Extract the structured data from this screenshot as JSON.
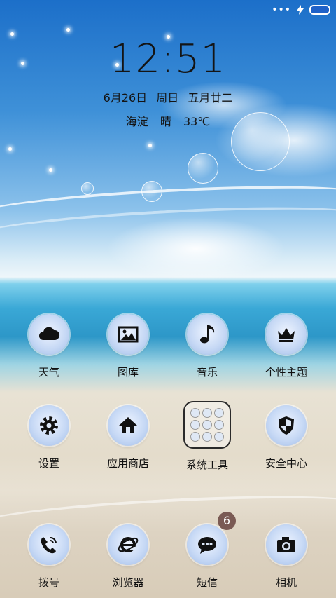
{
  "status_bar": {
    "signal_icon": "more-dots-icon",
    "charging_icon": "bolt-icon",
    "battery_icon": "battery-icon"
  },
  "lockscreen": {
    "time": "12:51",
    "date": "6月26日",
    "weekday": "周日",
    "lunar_date": "五月廿二",
    "location": "海淀",
    "condition": "晴",
    "temperature": "33℃"
  },
  "apps_row1": [
    {
      "label": "天气",
      "icon": "cloud-icon"
    },
    {
      "label": "图库",
      "icon": "image-icon"
    },
    {
      "label": "音乐",
      "icon": "music-note-icon"
    },
    {
      "label": "个性主题",
      "icon": "crown-icon"
    }
  ],
  "apps_row2": [
    {
      "label": "设置",
      "icon": "gear-icon"
    },
    {
      "label": "应用商店",
      "icon": "home-icon"
    },
    {
      "label": "系统工具",
      "icon": "folder-icon"
    },
    {
      "label": "安全中心",
      "icon": "shield-icon"
    }
  ],
  "dock": [
    {
      "label": "拨号",
      "icon": "phone-icon"
    },
    {
      "label": "浏览器",
      "icon": "browser-icon"
    },
    {
      "label": "短信",
      "icon": "message-icon",
      "badge": "6"
    },
    {
      "label": "相机",
      "icon": "camera-icon"
    }
  ],
  "colors": {
    "icon_glyph": "#111111",
    "battery_fill": "#1f62c8",
    "badge": "#7a5a54"
  }
}
